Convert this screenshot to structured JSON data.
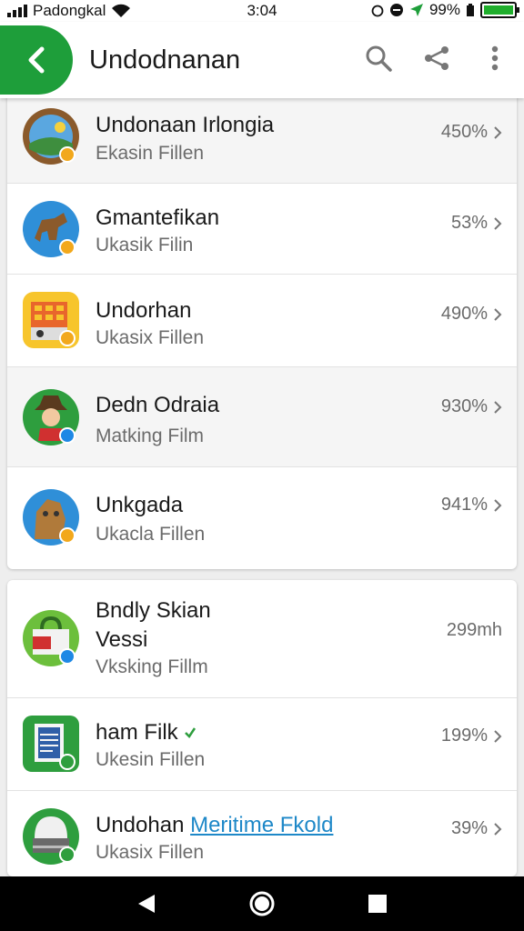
{
  "status_bar": {
    "carrier": "Padongkal",
    "time": "3:04",
    "battery": "99%",
    "battery_level": 0.99,
    "icons": [
      "signal-icon",
      "wifi-icon",
      "alarm-icon",
      "do-not-disturb-icon",
      "location-icon",
      "battery-icon"
    ]
  },
  "app_bar": {
    "title": "Undodnanan",
    "back_icon": "back-arrow-icon",
    "actions": [
      "search-icon",
      "share-icon",
      "more-vert-icon"
    ],
    "accent_color": "#1e9e3a"
  },
  "group_1": [
    {
      "title": "Undonaan Irlongia",
      "subtitle": "Ekasin Fillen",
      "value": "450%",
      "icon": "landscape-app-icon",
      "badge_color": "#f2a81c"
    },
    {
      "title": "Gmantefikan",
      "subtitle": "Ukasik Filin",
      "value": "53%",
      "icon": "dog-app-icon",
      "badge_color": "#f2a81c"
    },
    {
      "title": "Undorhan",
      "subtitle": "Ukasix Fillen",
      "value": "490%",
      "icon": "calendar-app-icon",
      "badge_color": "#f2a81c"
    },
    {
      "title": "Dedn Odraia",
      "subtitle": "Matking Film",
      "value": "930%",
      "icon": "cowboy-app-icon",
      "badge_color": "#1e88e5"
    },
    {
      "title": "Unkgada",
      "subtitle": "Ukacla Fillen",
      "value": "941%",
      "icon": "monkey-app-icon",
      "badge_color": "#f2a81c"
    }
  ],
  "group_2": [
    {
      "title": "Bndly Skian",
      "title_line2": "Vessi",
      "subtitle": "Vksking Fillm",
      "value": "299mh",
      "icon": "shopping-bag-app-icon",
      "badge_color": "#1e88e5"
    },
    {
      "title": "ham Filk",
      "subtitle": "Ukesin Fillen",
      "value": "199%",
      "icon": "document-app-icon",
      "badge_color": "#2e9e3e"
    },
    {
      "title": "Undohan",
      "title_link": "Meritime Fkold",
      "subtitle": "Ukasix Fillen",
      "value": "39%",
      "icon": "robot-app-icon",
      "badge_color": "#2e9e3e"
    }
  ],
  "nav_bar": {
    "buttons": [
      "back-triangle-icon",
      "home-circle-icon",
      "recents-square-icon"
    ]
  }
}
